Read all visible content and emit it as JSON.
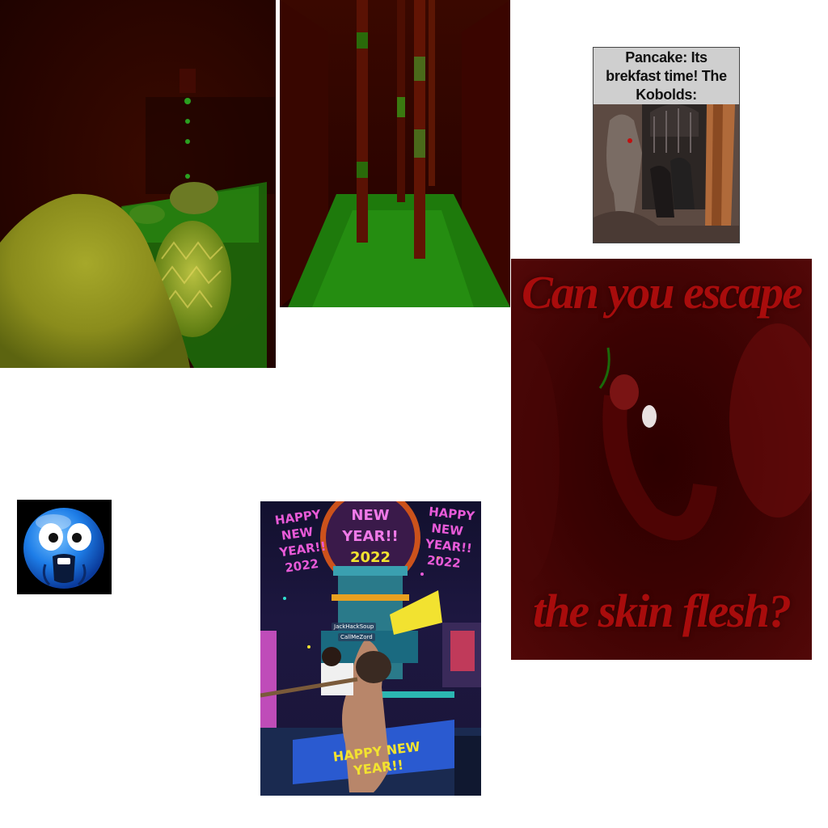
{
  "panels": {
    "kobolds_meme": {
      "caption": "Pancake: Its brekfast time! The Kobolds:"
    },
    "skin_flesh": {
      "line1": "Can you escape",
      "line2": "the skin flesh?"
    },
    "new_year": {
      "sign_left": "HAPPY NEW YEAR!! 2022",
      "sign_center_1": "NEW",
      "sign_center_2": "YEAR!!",
      "sign_center_3": "2022",
      "sign_right": "HAPPY NEW YEAR!! 2022",
      "name_tag_1": "JackHackSoup",
      "name_tag_2": "CallMeZord",
      "banner_bottom": "HAPPY NEW YEAR!!"
    }
  },
  "colors": {
    "background": "#ffffff",
    "flesh_text": "#a80c0c",
    "emoji_blue": "#1e7ee8",
    "neon_pink": "#e85ad8",
    "neon_yellow": "#f2e230"
  }
}
